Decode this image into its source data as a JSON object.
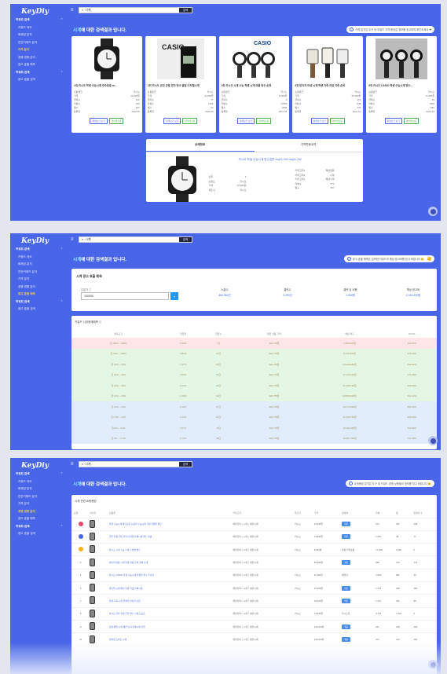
{
  "app": {
    "logo": "KeyDiy",
    "search_value": "시계",
    "search_button": "검색"
  },
  "sidebar": {
    "groups": [
      {
        "label": "키워드 검색",
        "items": [
          "키워드 개요",
          "화제성 분석",
          "연관키워드 분석",
          "가격 분석",
          "경쟁 경쟁 분석",
          "광고 효율 예측"
        ]
      },
      {
        "label": "키워드 검색",
        "items": [
          "광고 효율 검색"
        ]
      }
    ]
  },
  "panel1": {
    "active_item": "가격 분석",
    "header_keyword": "시계",
    "header_suffix": "에 대한 검색결과 입니다.",
    "notice": "가격 분석은 도구 내 키워드 가격 중앙값 정보를 참고하여 확인하세요 ❤",
    "cards": [
      {
        "title": "1위 카시오 학생 수능시계 방수표준 m...",
        "rows": [
          [
            "쇼핑랭크",
            "카시오"
          ],
          [
            "가격",
            "12,920원"
          ],
          [
            "클릭수",
            "135"
          ],
          [
            "리뷰수",
            "674"
          ],
          [
            "찜수",
            "197"
          ],
          [
            "등록일",
            "2022.05"
          ]
        ]
      },
      {
        "title": "2위 카시오 군인 군용 전자 방수 알림 디지털시계",
        "rows": [
          [
            "쇼핑랭크",
            "카시오"
          ],
          [
            "가격",
            "14,890원"
          ],
          [
            "클릭수",
            "77"
          ],
          [
            "리뷰수",
            "1251"
          ],
          [
            "찜수",
            "52"
          ],
          [
            "등록일",
            "2022.05"
          ]
        ]
      },
      {
        "title": "3위 카시오 시계 수능 학생 시계 여름 방수 손목",
        "rows": [
          [
            "쇼핑랭크",
            "카시오"
          ],
          [
            "가격",
            "8,300원"
          ],
          [
            "클릭수",
            "0"
          ],
          [
            "리뷰수",
            "17365"
          ],
          [
            "찜수",
            "2084"
          ],
          [
            "등록일",
            "2017.04"
          ]
        ]
      },
      {
        "title": "4위 빈티지 여성 시계 학생 가죽 여성 가죽 손목",
        "rows": [
          [
            "쇼핑랭크",
            "카시오"
          ],
          [
            "가격",
            "55,900원"
          ],
          [
            "클릭수",
            "174"
          ],
          [
            "리뷰수",
            "948"
          ],
          [
            "찜수",
            "270"
          ],
          [
            "등록일",
            "2021.12"
          ]
        ]
      },
      {
        "title": "5위 카시오 CASIO 학생 수능시계 방수...",
        "rows": [
          [
            "쇼핑랭크",
            "카시오"
          ],
          [
            "가격",
            "11,900원"
          ],
          [
            "클릭수",
            "49"
          ],
          [
            "리뷰수",
            "7803"
          ],
          [
            "찜수",
            "581"
          ],
          [
            "등록일",
            "2014.04"
          ]
        ]
      }
    ],
    "card_buttons": [
      "상세보기 보기",
      "네이버쇼핑"
    ],
    "detail_tabs": [
      "상세정보",
      "가격변동내역"
    ],
    "detail_link": "카시오 학생 수능시계 방수표준 mq24-7b2 mq24-7b2",
    "detail_left": [
      [
        "순위",
        "1"
      ],
      [
        "브랜드",
        "카시오"
      ],
      [
        "가격",
        "12,920원"
      ],
      [
        "제조사",
        "카시오"
      ]
    ],
    "detail_right": [
      [
        "카테고리1",
        "패션잡화"
      ],
      [
        "카테고리2",
        "시계"
      ],
      [
        "카테고리3",
        "패션시계"
      ],
      [
        "리뷰수",
        "674"
      ],
      [
        "찜수",
        "197"
      ]
    ]
  },
  "panel2": {
    "active_item": "광고 효율 예측",
    "header_keyword": "시계",
    "header_suffix": "에 대한 검색결과 입니다.",
    "notice": "광고 효율 예측은 입력한 키워드의 예상 광고비를 참고 바랍니다 😊",
    "box_title": "시계 광고 효율 예측",
    "input_label": "입찰가 ⓘ",
    "input_value": "100000",
    "stats": [
      {
        "label": "노출수",
        "value": "360,963건"
      },
      {
        "label": "클릭수",
        "value": "2,290건"
      },
      {
        "label": "클릭 당 비용",
        "value": "1,064원"
      },
      {
        "label": "예상 광고비",
        "value": "2,316,434원"
      }
    ],
    "table_title": "키워드 시장현재예측 ⓘ",
    "table_headers": [
      "예측구간",
      "전환율",
      "전환수",
      "평균 상품 가격",
      "예상 매출",
      "ROAS"
    ],
    "rows": [
      [
        "전 100% ~ 400%",
        "0.33%",
        "7건",
        "420,778원",
        "2,945,000원",
        "132.87%"
      ],
      [
        "전 60% ~ 100%",
        "0.81%",
        "20건",
        "420,778원",
        "8,415,500원",
        "376.63%"
      ],
      [
        "전 40% ~ 60%",
        "1.17%",
        "26건",
        "420,778원",
        "10,938,980원",
        "493.52%"
      ],
      [
        "전 30% ~ 40%",
        "1.84%",
        "41건",
        "420,778원",
        "17,245,310원",
        "776.25%"
      ],
      [
        "전 20% ~ 30%",
        "2.27%",
        "50건",
        "420,778원",
        "21,038,790원",
        "949.09%"
      ],
      [
        "전 10% ~ 20%",
        "2.16%",
        "49건",
        "420,778원",
        "20,596,020원",
        "911.12%"
      ],
      [
        "전 10% ~ 10%",
        "2.16%",
        "47건",
        "420,778원",
        "19,770,600원",
        "893.56%"
      ],
      [
        "전 0.0% ~ 10%",
        "2.27%",
        "50건",
        "420,778원",
        "21,035,750원",
        "949.09%"
      ],
      [
        "전 0% ~ 0.0%",
        "2.07%",
        "46건",
        "420,778원",
        "19,352,660원",
        "873.95%"
      ],
      [
        "전 0% ~ -0.0%",
        "1.74%",
        "38건",
        "420,778원",
        "15,987,700원",
        "721.35%"
      ]
    ]
  },
  "panel3": {
    "active_item": "경쟁 경쟁 분석",
    "header_keyword": "시계",
    "header_suffix": "에 대한 검색결과 입니다.",
    "notice": "쇼핑랭킹 분석은 도구 내 키워드 경쟁 상품들의 정보를 참고 바랍니다 😊",
    "box_title": "시계 관련 쇼핑랭킹",
    "headers": [
      "순위",
      "이미지",
      "상품명",
      "카테고리",
      "제조사",
      "가격",
      "판매처",
      "리뷰",
      "찜",
      "판매자 수"
    ],
    "rows": [
      [
        "1",
        "학생 수능시계 방수표준 시공여 수능시계 가성 저렴한 방수",
        "패션잡화 > 시계 > 패션시계",
        "카시오",
        "12,920원",
        "쿠팡",
        "674",
        "197",
        "105"
      ],
      [
        "2",
        "군인 전용 군대 전자 디지털 손목시계 방수 야광",
        "패션잡화 > 시계 > 패션시계",
        "카시오",
        "14,890원",
        "쿠팡",
        "1,251",
        "49",
        "77"
      ],
      [
        "3",
        "카시오 시계 수능 시계 수험생 방수",
        "패션잡화 > 시계 > 패션시계",
        "카시오",
        "8,300원",
        "살림 기업쇼핑",
        "17,365",
        "2,084",
        "0"
      ],
      [
        "4",
        "빈티지 여성 시계 학생 여성 가죽 손목 시계",
        "패션잡화 > 시계 > 패션시계",
        "",
        "55,900원",
        "쿠팡",
        "948",
        "270",
        "174"
      ],
      [
        "5",
        "카시오 CASIO 학생 수능시계 저렴한 방수 주니어",
        "패션잡화 > 시계 > 패션시계",
        "카시오",
        "11,900원",
        "패션샵",
        "7,803",
        "581",
        "49"
      ],
      [
        "6",
        "미니멀 시계 패션 남성 학생 손목시계",
        "패션잡화 > 시계 > 패션시계",
        "카시오",
        "37,000원",
        "쿠팡",
        "1,714",
        "248",
        "180"
      ],
      [
        "7",
        "학생 가죽 시계 클래식 빈티지 선물",
        "패션잡화 > 시계 > 패션시계",
        "",
        "16,600원",
        "쿠팡",
        "1,331",
        "391",
        "95"
      ],
      [
        "8",
        "카시오 전자 학생 군인 방수 시계 스포츠",
        "패션잡화 > 시계 > 패션시계",
        "카시오",
        "13,900원",
        "카시오샵",
        "4,716",
        "1,018",
        "0"
      ],
      [
        "9",
        "남성 메탈 시계 패션 남자 손목시계 선물",
        "패션잡화 > 시계 > 패션시계",
        "",
        "176,000원",
        "쿠팡",
        "227",
        "248",
        "106"
      ],
      [
        "10",
        "설치형 스마트 시계",
        "패션잡화 > 시계 > 패션시계",
        "",
        "176,000원",
        "쿠팡",
        "374",
        "122",
        "152"
      ]
    ]
  },
  "colors": {
    "brand": "#4a66e8",
    "notice_icon": "#4a66e8",
    "badge": "#4a8de8"
  }
}
